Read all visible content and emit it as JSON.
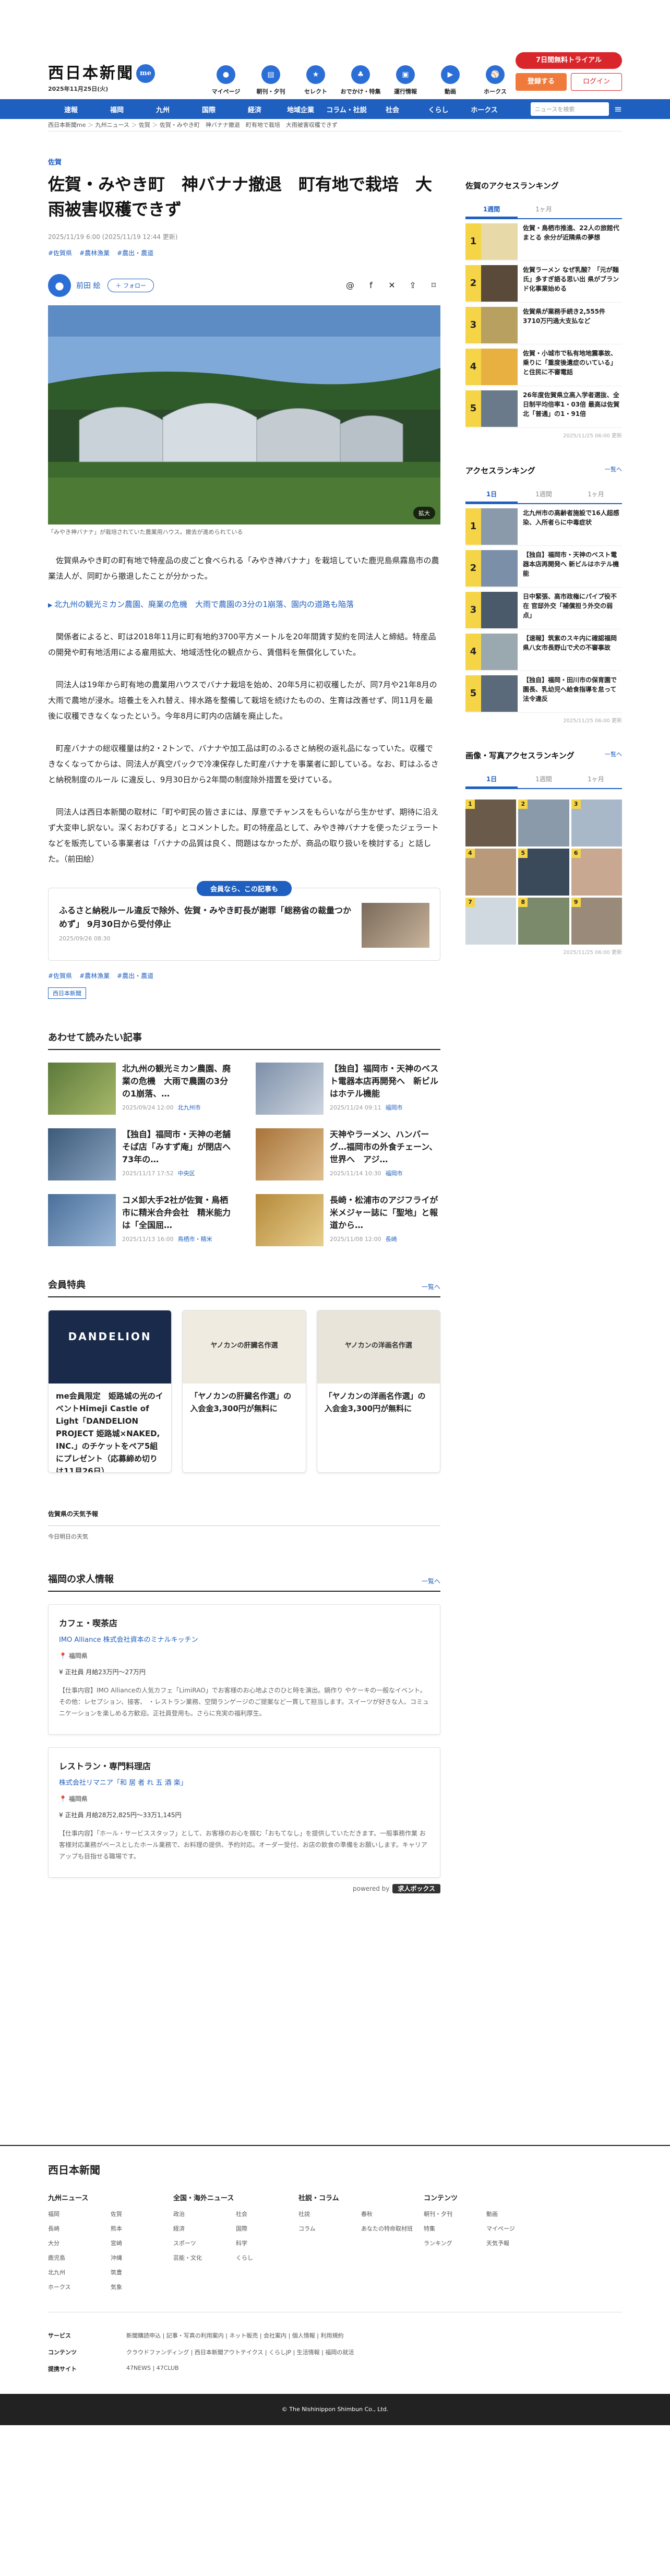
{
  "header": {
    "logo": "西日本新聞",
    "logo_badge": "me",
    "date": "2025年11月25日(火)",
    "nav": [
      {
        "label": "マイページ",
        "icon": "person-icon"
      },
      {
        "label": "朝刊・夕刊",
        "icon": "newspaper-icon"
      },
      {
        "label": "セレクト",
        "icon": "star-icon"
      },
      {
        "label": "おでかけ・特集",
        "icon": "walk-icon"
      },
      {
        "label": "運行情報",
        "icon": "train-icon"
      },
      {
        "label": "動画",
        "icon": "video-icon"
      },
      {
        "label": "ホークス",
        "icon": "baseball-icon"
      }
    ],
    "trial": "7日間無料トライアル",
    "register": "登録する",
    "login": "ログイン"
  },
  "categories": [
    "速報",
    "福岡",
    "九州",
    "国際",
    "経済",
    "地域企業",
    "コラム・社説",
    "社会",
    "くらし",
    "ホークス"
  ],
  "search": {
    "placeholder": "ニュースを検索"
  },
  "breadcrumb": [
    "西日本新聞me",
    "九州ニュース",
    "佐賀",
    "佐賀・みやき町　神バナナ撤退　町有地で栽培　大雨被害収穫できず"
  ],
  "article": {
    "section": "佐賀",
    "title": "佐賀・みやき町　神バナナ撤退　町有地で栽培　大雨被害収穫できず",
    "meta": "2025/11/19 6:00 (2025/11/19 12:44 更新)",
    "tags": [
      "#佐賀県",
      "#農林漁業",
      "#農出・農道"
    ],
    "author": "前田 絵",
    "follow": "＋ フォロー",
    "enlarge": "拡大",
    "caption": "「みやき神バナナ」が栽培されていた農業用ハウス。撤去が進められている",
    "paragraphs": [
      "佐賀県みやき町の町有地で特産品の皮ごと食べられる「みやき神バナナ」を栽培していた鹿児島県霧島市の農業法人が、同町から撤退したことが分かった。",
      "関係者によると、町は2018年11月に町有地約3700平方メートルを20年間賃す契約を同法人と締結。特産品の開発や町有地活用による雇用拡大、地域活性化の観点から、賃借料を無償化していた。",
      "同法人は19年から町有地の農業用ハウスでバナナ栽培を始め、20年5月に初収穫したが、同7月や21年8月の大雨で農地が浸水。培養土を入れ替え、排水路を整備して栽培を続けたものの、生育は改善せず、同11月を最後に収穫できなくなったという。今年8月に町内の店舗を廃止した。",
      "町産バナナの総収穫量は約2・2トンで、バナナや加工品は町のふるさと納税の返礼品になっていた。収穫できなくなってからは、同法人が真空パックで冷凍保存した町産バナナを事業者に卸している。なお、町はふるさと納税制度のルール に違反し、9月30日から2年間の制度除外措置を受けている。",
      "同法人は西日本新聞の取材に「町や町民の皆さまには、厚意でチャンスをもらいながら生かせず、期待に沿えず大変申し訳ない。深くおわびする」とコメントした。町の特産品として、みやき神バナナを使ったジェラートなどを販売している事業者は「バナナの品質は良く、問題はなかったが、商品の取り扱いを検討する」と話した。（前田絵）"
    ],
    "related_link": "北九州の観光ミカン農園、廃業の危機　大雨で農園の3分の1崩落、園内の道路も陥落",
    "promo_head": "会員なら、この記事も",
    "promo_title": "ふるさと納税ルール違反で除外、佐賀・みやき町長が謝罪「総務省の裁量つかめず」 9月30日から受付停止",
    "promo_date": "2025/09/26 08:30",
    "bottom_tags": [
      "#佐賀県",
      "#農林漁業",
      "#農出・農道"
    ],
    "publisher": "西日本新聞"
  },
  "related": {
    "heading": "あわせて読みたい記事",
    "items": [
      {
        "title": "北九州の観光ミカン農園、廃業の危機　大雨で農園の3分の1崩落、…",
        "date": "2025/09/24 12:00",
        "tag": "北九州市"
      },
      {
        "title": "【独自】福岡市・天神のベスト電器本店再開発へ　新ビルはホテル機能",
        "date": "2025/11/24 09:11",
        "tag": "福岡市"
      },
      {
        "title": "【独自】福岡市・天神の老舗そば店「みすず庵」が閉店へ　73年の…",
        "date": "2025/11/17 17:52",
        "tag": "中央区"
      },
      {
        "title": "天神やラーメン、ハンバーグ…福岡市の外食チェーン、世界へ　アジ…",
        "date": "2025/11/14 10:30",
        "tag": "福岡市"
      },
      {
        "title": "コメ卸大手2社が佐賀・鳥栖市に精米合弁会社　精米能力は「全国屈…",
        "date": "2025/11/13 16:00",
        "tag": "鳥栖市・精米"
      },
      {
        "title": "長崎・松浦市のアジフライが米メジャー誌に「聖地」と報道から…",
        "date": "2025/11/08 12:00",
        "tag": "長崎"
      }
    ]
  },
  "perks": {
    "heading": "会員特典",
    "more": "一覧へ",
    "items": [
      {
        "title": "me会員限定　姫路城の光のイベントHimeji Castle of Light「DANDELION PROJECT 姫路城×NAKED, INC.」のチケットをペア5組にプレゼント（応募締め切りは11月26日）",
        "img_text": "DANDELION"
      },
      {
        "title": "「ヤノカンの肝臓名作選」の入会金3,300円が無料に",
        "img_text": "ヤノカンの肝臓名作選"
      },
      {
        "title": "「ヤノカンの洋画名作選」の入会金3,300円が無料に",
        "img_text": "ヤノカンの洋画名作選"
      }
    ]
  },
  "weather": {
    "heading": "佐賀県の天気予報",
    "body": "今日明日の天気"
  },
  "jobs": {
    "heading": "福岡の求人情報",
    "more": "一覧へ",
    "items": [
      {
        "title": "カフェ・喫茶店",
        "company": "IMO Alliance 株式会社資本のミナルキッチン",
        "place": "福岡県",
        "pay": "正社員 月給23万円〜27万円",
        "desc": "【仕事内容】IMO Allianceの人気カフェ「LimiRAO」でお客様のお心地よさのひと時を演出。鍋作り やケーキの一般なイベント。その他：レセプション、接客、 ・レストラン業務、空間ランゲージのご提案など一貫して担当します。スイーツが好きな人、コミュニケーションを楽しめる方歓迎。正社員登用も。さらに充実の福利厚生。"
      },
      {
        "title": "レストラン・専門料理店",
        "company": "株式会社リマニア「和 居 者 れ 五 酒 楽」",
        "place": "福岡県",
        "pay": "正社員 月給28万2,825円〜33万1,145円",
        "desc": "【仕事内容】「ホール・サービススタッフ」として、お客様のお心を掴む「おもてなし」を提供していただきます。一般事務作業 お客様対応業務がベースとしたホール業務で、お料理の提供、予約対応。オーダー受付、お店の飲食の準備をお願いします。キャリアアップも目指せる職場です。"
      }
    ],
    "powered": "powered by",
    "powered_brand": "求人ボックス"
  },
  "sidebar": {
    "access_heading": "佐賀のアクセスランキング",
    "tabs": [
      "1週間",
      "1ヶ月"
    ],
    "ranking": [
      {
        "no": "1",
        "title": "佐賀・鳥栖市推進、22人の旅館代まとる 余分が近隣県の夢想"
      },
      {
        "no": "2",
        "title": "佐賀ラーメン なぜ乳酸？「元が麺氏」多すぎ語る思い出 県がブランド化事業始める"
      },
      {
        "no": "3",
        "title": "佐賀県が業務手続き2,555件 3710万円過大支払など"
      },
      {
        "no": "4",
        "title": "佐賀・小城市で私有地地震事故、乗りに「重度後遺症のいている」と住民に不審電話"
      },
      {
        "no": "5",
        "title": "26年度佐賀県立高入学者選抜、全日制平均倍率1・03倍 最高は佐賀北「普通」の1・91倍"
      }
    ],
    "access_time": "2025/11/25 06:00 更新",
    "access2_heading": "アクセスランキング",
    "access2_more": "一覧へ",
    "tabs2": [
      "1日",
      "1週間",
      "1ヶ月"
    ],
    "ranking2": [
      {
        "no": "1",
        "title": "北九州市の高齢者施設で16人超感染、入所者らに中毒症状"
      },
      {
        "no": "2",
        "title": "【独自】福岡市・天神のベスト電器本店再開発へ 新ビルはホテル機能"
      },
      {
        "no": "3",
        "title": "日中緊張、高市政権にパイプ役不在 官邸外交「補償担う外交の弱点」"
      },
      {
        "no": "4",
        "title": "【速報】筑紫のスキ内に確認福岡県八女市長野山で犬の不審事故"
      },
      {
        "no": "5",
        "title": "【独自】福岡・田川市の保育園で園長、乳幼児へ給食指導を怠って法令違反"
      }
    ],
    "access2_time": "2025/11/25 06:00 更新",
    "image_heading": "画像・写真アクセスランキング",
    "image_more": "一覧へ",
    "tabs3": [
      "1日",
      "1週間",
      "1ヶ月"
    ],
    "image_time": "2025/11/25 06:00 更新"
  },
  "footer": {
    "logo": "西日本新聞",
    "columns": [
      {
        "heading": "九州ニュース",
        "items": [
          "福岡",
          "佐賀",
          "長崎",
          "熊本",
          "大分",
          "宮崎",
          "鹿児島",
          "沖縄",
          "北九州",
          "筑豊",
          "ホークス",
          "気象"
        ]
      },
      {
        "heading": "全国・海外ニュース",
        "items": [
          "政治",
          "社会",
          "経済",
          "国際",
          "スポーツ",
          "科学",
          "芸能・文化",
          "くらし"
        ]
      },
      {
        "heading": "社説・コラム",
        "items": [
          "社説",
          "春秋",
          "コラム",
          "あなたの特命取材班"
        ]
      },
      {
        "heading": "コンテンツ",
        "items": [
          "朝刊・夕刊",
          "動画",
          "特集",
          "マイページ",
          "ランキング",
          "天気予報"
        ]
      }
    ],
    "rows": [
      {
        "heading": "サービス",
        "value": "新聞購読申込 | 記事・写真の利用案内 | ネット販売 | 会社案内 | 個人情報 | 利用規約"
      },
      {
        "heading": "コンテンツ",
        "value": "クラウドファンディング | 西日本新聞アウトテイクス | くらしJP | 生活情報 | 福岡の就活"
      },
      {
        "heading": "提携サイト",
        "value": "47NEWS | 47CLUB"
      }
    ],
    "copyright": "© The Nishinippon Shimbun Co., Ltd."
  },
  "colors": {
    "brand": "#1f5fbf",
    "accent": "#d8262a",
    "rank": "#f5d547"
  }
}
